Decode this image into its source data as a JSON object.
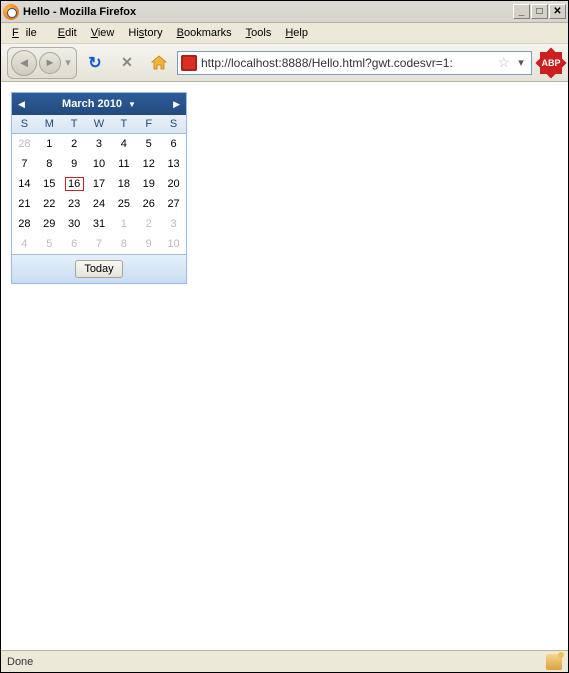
{
  "titlebar": {
    "text": "Hello - Mozilla Firefox"
  },
  "menubar": {
    "file": "File",
    "edit": "Edit",
    "view": "View",
    "history": "History",
    "bookmarks": "Bookmarks",
    "tools": "Tools",
    "help": "Help"
  },
  "toolbar": {
    "url": "http://localhost:8888/Hello.html?gwt.codesvr=1:",
    "abp": "ABP"
  },
  "calendar": {
    "title": "March 2010",
    "day_headers": [
      "S",
      "M",
      "T",
      "W",
      "T",
      "F",
      "S"
    ],
    "weeks": [
      [
        {
          "n": "28",
          "o": true
        },
        {
          "n": "1"
        },
        {
          "n": "2"
        },
        {
          "n": "3"
        },
        {
          "n": "4"
        },
        {
          "n": "5"
        },
        {
          "n": "6"
        }
      ],
      [
        {
          "n": "7"
        },
        {
          "n": "8"
        },
        {
          "n": "9"
        },
        {
          "n": "10"
        },
        {
          "n": "11"
        },
        {
          "n": "12"
        },
        {
          "n": "13"
        }
      ],
      [
        {
          "n": "14"
        },
        {
          "n": "15"
        },
        {
          "n": "16",
          "today": true
        },
        {
          "n": "17"
        },
        {
          "n": "18"
        },
        {
          "n": "19"
        },
        {
          "n": "20"
        }
      ],
      [
        {
          "n": "21"
        },
        {
          "n": "22"
        },
        {
          "n": "23"
        },
        {
          "n": "24"
        },
        {
          "n": "25"
        },
        {
          "n": "26"
        },
        {
          "n": "27"
        }
      ],
      [
        {
          "n": "28"
        },
        {
          "n": "29"
        },
        {
          "n": "30"
        },
        {
          "n": "31"
        },
        {
          "n": "1",
          "o": true
        },
        {
          "n": "2",
          "o": true
        },
        {
          "n": "3",
          "o": true
        }
      ],
      [
        {
          "n": "4",
          "o": true
        },
        {
          "n": "5",
          "o": true
        },
        {
          "n": "6",
          "o": true
        },
        {
          "n": "7",
          "o": true
        },
        {
          "n": "8",
          "o": true
        },
        {
          "n": "9",
          "o": true
        },
        {
          "n": "10",
          "o": true
        }
      ]
    ],
    "today_label": "Today"
  },
  "statusbar": {
    "text": "Done"
  }
}
